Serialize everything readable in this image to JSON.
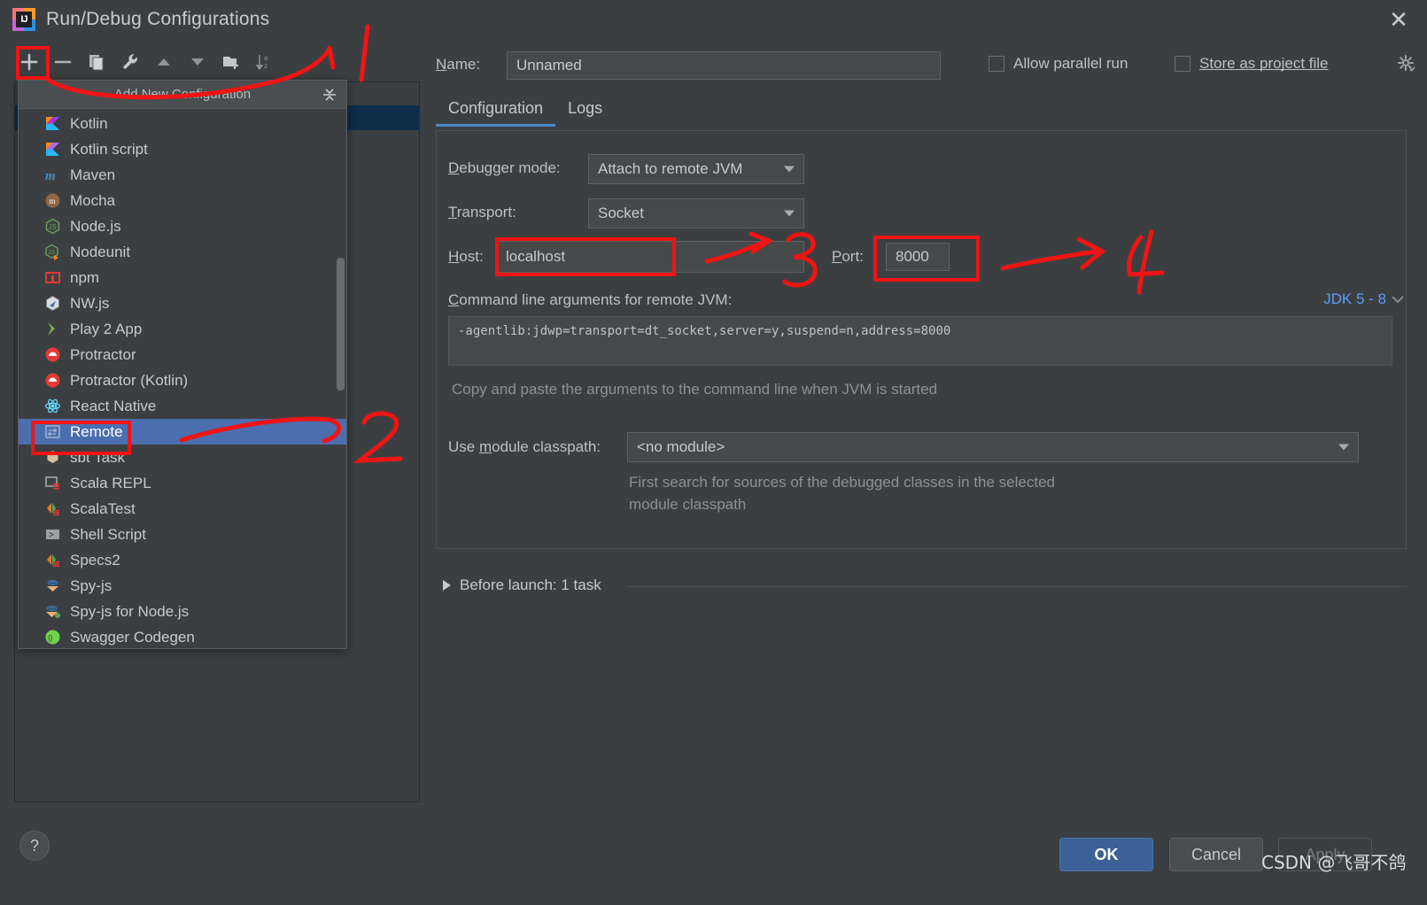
{
  "window": {
    "title": "Run/Debug Configurations",
    "close_icon": "close-icon",
    "app_icon": "intellij-idea-logo"
  },
  "toolbar": {
    "buttons": [
      {
        "name": "add-configuration",
        "icon": "plus-icon",
        "label": "+"
      },
      {
        "name": "remove-configuration",
        "icon": "minus-icon",
        "label": "−"
      },
      {
        "name": "copy-configuration",
        "icon": "copy-icon",
        "label": ""
      },
      {
        "name": "edit-templates",
        "icon": "wrench-icon",
        "label": ""
      },
      {
        "name": "move-up",
        "icon": "arrow-up-icon",
        "label": ""
      },
      {
        "name": "move-down",
        "icon": "arrow-down-icon",
        "label": ""
      },
      {
        "name": "new-folder",
        "icon": "folder-add-icon",
        "label": ""
      },
      {
        "name": "sort-alphabetically",
        "icon": "sort-az-icon",
        "label": ""
      }
    ]
  },
  "popup": {
    "title": "Add New Configuration",
    "collapse_icon": "collapse-all-icon",
    "items": [
      {
        "label": "Kotlin",
        "icon": "kotlin-icon",
        "selected": false
      },
      {
        "label": "Kotlin script",
        "icon": "kotlin-script-icon",
        "selected": false
      },
      {
        "label": "Maven",
        "icon": "maven-icon",
        "selected": false
      },
      {
        "label": "Mocha",
        "icon": "mocha-icon",
        "selected": false
      },
      {
        "label": "Node.js",
        "icon": "nodejs-icon",
        "selected": false
      },
      {
        "label": "Nodeunit",
        "icon": "nodeunit-icon",
        "selected": false
      },
      {
        "label": "npm",
        "icon": "npm-icon",
        "selected": false
      },
      {
        "label": "NW.js",
        "icon": "nwjs-icon",
        "selected": false
      },
      {
        "label": "Play 2 App",
        "icon": "play2-icon",
        "selected": false
      },
      {
        "label": "Protractor",
        "icon": "protractor-icon",
        "selected": false
      },
      {
        "label": "Protractor (Kotlin)",
        "icon": "protractor-kotlin-icon",
        "selected": false
      },
      {
        "label": "React Native",
        "icon": "react-native-icon",
        "selected": false
      },
      {
        "label": "Remote",
        "icon": "remote-icon",
        "selected": true
      },
      {
        "label": "sbt Task",
        "icon": "sbt-icon",
        "selected": false
      },
      {
        "label": "Scala REPL",
        "icon": "scala-repl-icon",
        "selected": false
      },
      {
        "label": "ScalaTest",
        "icon": "scalatest-icon",
        "selected": false
      },
      {
        "label": "Shell Script",
        "icon": "shell-script-icon",
        "selected": false
      },
      {
        "label": "Specs2",
        "icon": "specs2-icon",
        "selected": false
      },
      {
        "label": "Spy-js",
        "icon": "spyjs-icon",
        "selected": false
      },
      {
        "label": "Spy-js for Node.js",
        "icon": "spyjs-node-icon",
        "selected": false
      },
      {
        "label": "Swagger Codegen",
        "icon": "swagger-icon",
        "selected": false
      }
    ]
  },
  "form": {
    "name_label": "Name:",
    "name_value": "Unnamed",
    "allow_parallel_run": "Allow parallel run",
    "store_as_project_file": "Store as project file",
    "gear_icon": "gear-icon",
    "tabs": [
      {
        "label": "Configuration",
        "active": true
      },
      {
        "label": "Logs",
        "active": false
      }
    ],
    "debugger_mode_label": "Debugger mode:",
    "debugger_mode_value": "Attach to remote JVM",
    "transport_label": "Transport:",
    "transport_value": "Socket",
    "host_label": "Host:",
    "host_value": "localhost",
    "port_label": "Port:",
    "port_value": "8000",
    "args_label": "Command line arguments for remote JVM:",
    "args_value": "-agentlib:jdwp=transport=dt_socket,server=y,suspend=n,address=8000",
    "jdk_link": "JDK 5 - 8",
    "jdk_chevron_icon": "chevron-down-icon",
    "copy_hint": "Copy and paste the arguments to the command line when JVM is started",
    "module_classpath_label": "Use module classpath:",
    "module_classpath_value": "<no module>",
    "module_hint_line1": "First search for sources of the debugged classes in the selected",
    "module_hint_line2": "module classpath",
    "before_launch": "Before launch: 1 task",
    "before_launch_icon": "expand-triangle-icon"
  },
  "buttons": {
    "help": "?",
    "ok": "OK",
    "cancel": "Cancel",
    "apply": "Apply"
  },
  "annotations": {
    "step1": "1",
    "step2": "2",
    "step3": "3",
    "step4": "4",
    "color": "#f01414"
  },
  "watermark": "CSDN @飞哥不鸽"
}
